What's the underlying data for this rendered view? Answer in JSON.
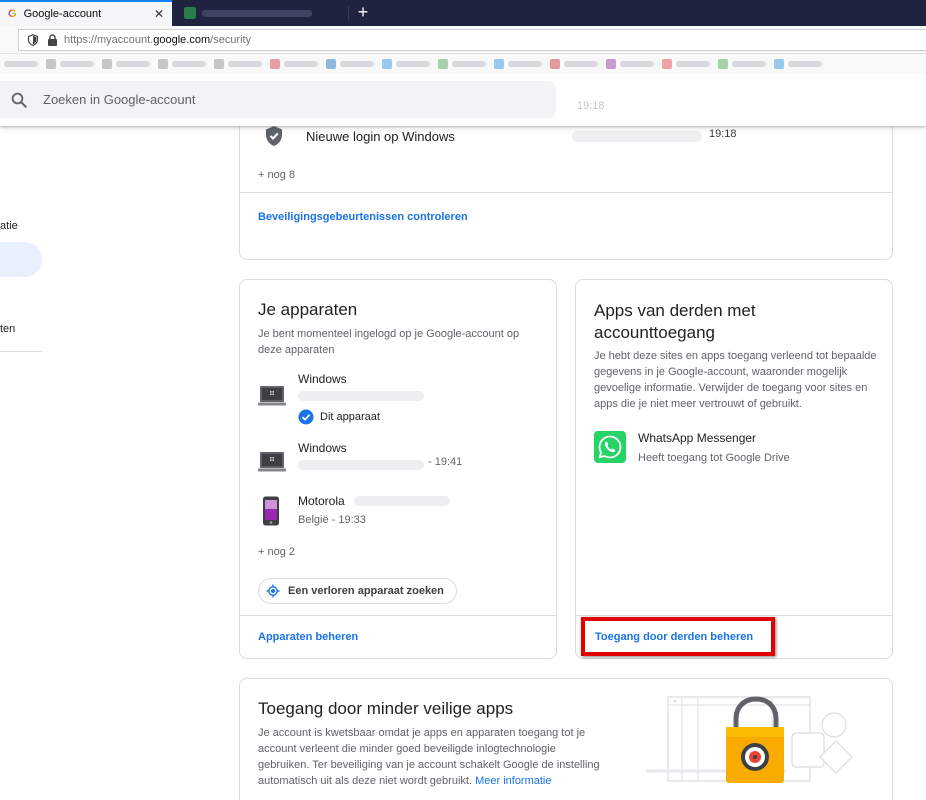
{
  "browser": {
    "active_tab_title": "Google-account",
    "url_prefix": "https://myaccount.",
    "url_domain": "google.com",
    "url_path": "/security",
    "new_tab_label": "+"
  },
  "search": {
    "placeholder": "Zoeken in Google-account"
  },
  "header": {
    "ghost_time": "19:18"
  },
  "nav": {
    "item_partial_1": "atie",
    "item_partial_2": "ten"
  },
  "security_events": {
    "event_label": "Nieuwe login op Windows",
    "event_time": "19:18",
    "more": "+ nog 8",
    "link": "Beveiligingsgebeurtenissen controleren"
  },
  "devices": {
    "title": "Je apparaten",
    "description": "Je bent momenteel ingelogd op je Google-account op deze apparaten",
    "items": [
      {
        "name": "Windows",
        "status": "Dit apparaat"
      },
      {
        "name": "Windows",
        "time": "- 19:41"
      },
      {
        "name": "Motorola",
        "location": "België - 19:33"
      }
    ],
    "more": "+ nog 2",
    "find_button": "Een verloren apparaat zoeken",
    "link": "Apparaten beheren"
  },
  "third_party": {
    "title": "Apps van derden met accounttoegang",
    "description": "Je hebt deze sites en apps toegang verleend tot bepaalde gegevens in je Google-account, waaronder mogelijk gevoelige informatie. Verwijder de toegang voor sites en apps die je niet meer vertrouwt of gebruikt.",
    "app_name": "WhatsApp Messenger",
    "app_access": "Heeft toegang tot Google Drive",
    "link": "Toegang door derden beheren"
  },
  "less_secure": {
    "title": "Toegang door minder veilige apps",
    "description": "Je account is kwetsbaar omdat je apps en apparaten toegang tot je account verleent die minder goed beveiligde inlogtechnologie gebruiken. Ter beveiliging van je account schakelt Google de instelling automatisch uit als deze niet wordt gebruikt.",
    "more_info": "Meer informatie"
  },
  "colors": {
    "link_blue": "#1a73e8",
    "highlight_red": "#e50000",
    "whatsapp_green": "#25d366"
  }
}
